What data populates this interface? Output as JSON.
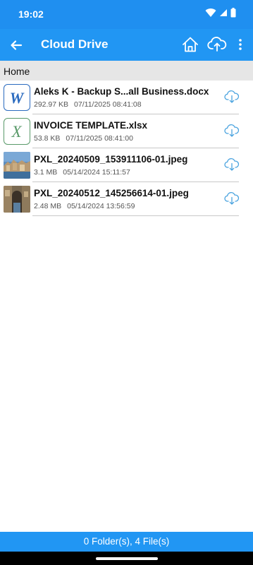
{
  "status_bar": {
    "time": "19:02"
  },
  "app_bar": {
    "title": "Cloud Drive",
    "back_icon": "arrow-back-icon",
    "home_icon": "home-icon",
    "upload_icon": "cloud-upload-icon",
    "more_icon": "more-vert-icon"
  },
  "breadcrumb": {
    "label": "Home"
  },
  "files": [
    {
      "name": "Aleks K - Backup S...all Business.docx",
      "size": "292.97 KB",
      "date": "07/11/2025 08:41:08",
      "type": "word",
      "icon": "word-doc-icon"
    },
    {
      "name": "INVOICE TEMPLATE.xlsx",
      "size": "53.8 KB",
      "date": "07/11/2025 08:41:00",
      "type": "excel",
      "icon": "excel-sheet-icon"
    },
    {
      "name": "PXL_20240509_153911106-01.jpeg",
      "size": "3.1 MB",
      "date": "05/14/2024 15:11:57",
      "type": "image",
      "icon": "image-thumbnail"
    },
    {
      "name": "PXL_20240512_145256614-01.jpeg",
      "size": "2.48 MB",
      "date": "05/14/2024 13:56:59",
      "type": "image",
      "icon": "image-thumbnail"
    }
  ],
  "footer": {
    "summary": "0 Folder(s), 4 File(s)"
  },
  "colors": {
    "status_bar": "#1f8ff0",
    "app_bar": "#2196f3",
    "breadcrumb_bg": "#e6e6e6",
    "download_icon": "#4aa3df"
  }
}
